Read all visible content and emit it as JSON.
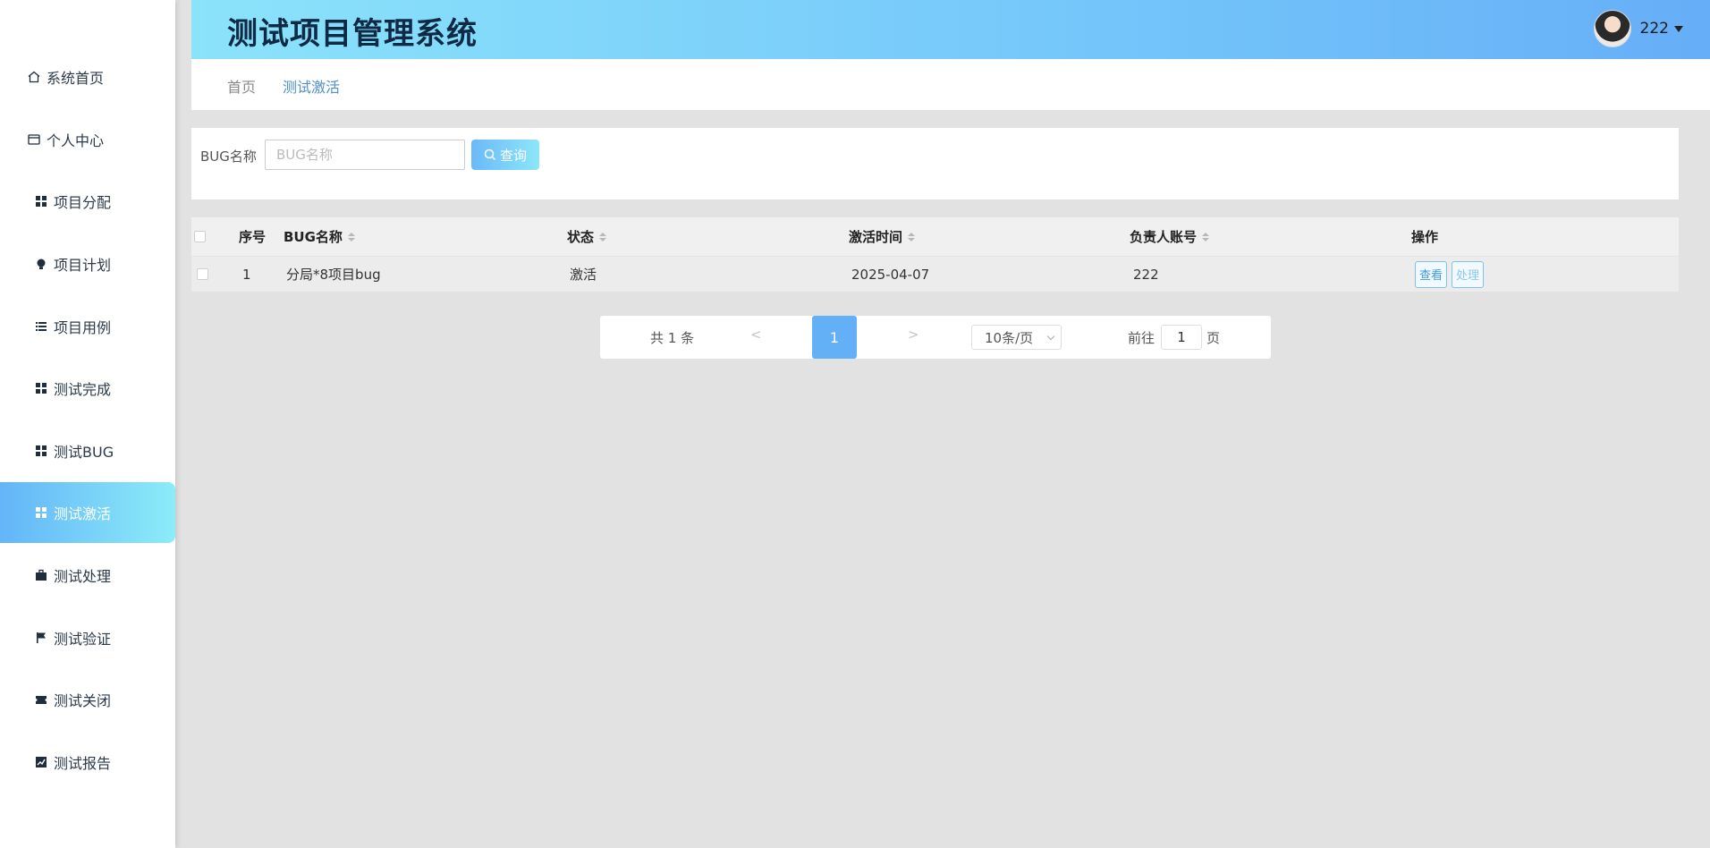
{
  "app": {
    "title": "测试项目管理系统"
  },
  "user": {
    "name": "222"
  },
  "sidebar": {
    "items": [
      {
        "label": "系统首页",
        "icon": "home-icon"
      },
      {
        "label": "个人中心",
        "icon": "wallet-icon"
      },
      {
        "label": "项目分配",
        "icon": "grid-icon"
      },
      {
        "label": "项目计划",
        "icon": "bulb-icon"
      },
      {
        "label": "项目用例",
        "icon": "list-icon"
      },
      {
        "label": "测试完成",
        "icon": "grid-icon"
      },
      {
        "label": "测试BUG",
        "icon": "grid-icon"
      },
      {
        "label": "测试激活",
        "icon": "grid-icon",
        "active": true
      },
      {
        "label": "测试处理",
        "icon": "briefcase-icon"
      },
      {
        "label": "测试验证",
        "icon": "flag-icon"
      },
      {
        "label": "测试关闭",
        "icon": "ticket-icon"
      },
      {
        "label": "测试报告",
        "icon": "chart-icon"
      }
    ]
  },
  "breadcrumb": {
    "home": "首页",
    "current": "测试激活"
  },
  "search": {
    "label": "BUG名称",
    "placeholder": "BUG名称",
    "button": "查询"
  },
  "table": {
    "headers": {
      "index": "序号",
      "name": "BUG名称",
      "status": "状态",
      "time": "激活时间",
      "owner": "负责人账号",
      "ops": "操作"
    },
    "rows": [
      {
        "index": "1",
        "name": "分局*8项目bug",
        "status": "激活",
        "time": "2025-04-07",
        "owner": "222",
        "view": "查看",
        "handle": "处理"
      }
    ]
  },
  "pagination": {
    "total": "共 1 条",
    "prev": "<",
    "current_page": "1",
    "next": ">",
    "page_size": "10条/页",
    "goto_label": "前往",
    "goto_value": "1",
    "page_label": "页"
  },
  "colors": {
    "accent": "#64b0f7",
    "header_start": "#8be3fa",
    "header_end": "#66aef7"
  }
}
